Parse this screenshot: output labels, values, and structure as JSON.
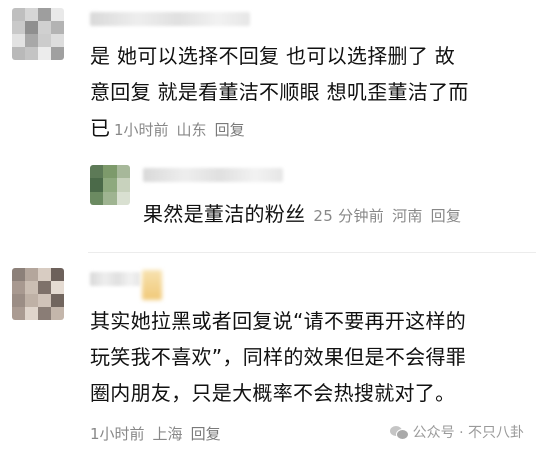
{
  "comments": [
    {
      "text_lines": [
        "是  她可以选择不回复 也可以选择删了  故",
        "意回复  就是看董洁不顺眼 想叽歪董洁了而",
        "已"
      ],
      "time": "1小时前",
      "location": "山东",
      "reply_label": "回复"
    },
    {
      "text": "其实她拉黑或者回复说“请不要再开这样的",
      "text_lines": [
        "其实她拉黑或者回复说“请不要再开这样的",
        "玩笑我不喜欢”，同样的效果但是不会得罪",
        "圈内朋友，只是大概率不会热搜就对了。"
      ],
      "time": "1小时前",
      "location": "上海",
      "reply_label": "回复"
    }
  ],
  "sub_reply": {
    "text": "果然是董洁的粉丝",
    "time": "25 分钟前",
    "location": "河南",
    "reply_label": "回复"
  },
  "watermark": {
    "text": "公众号 · 不只八卦",
    "icon": "wechat-icon"
  }
}
